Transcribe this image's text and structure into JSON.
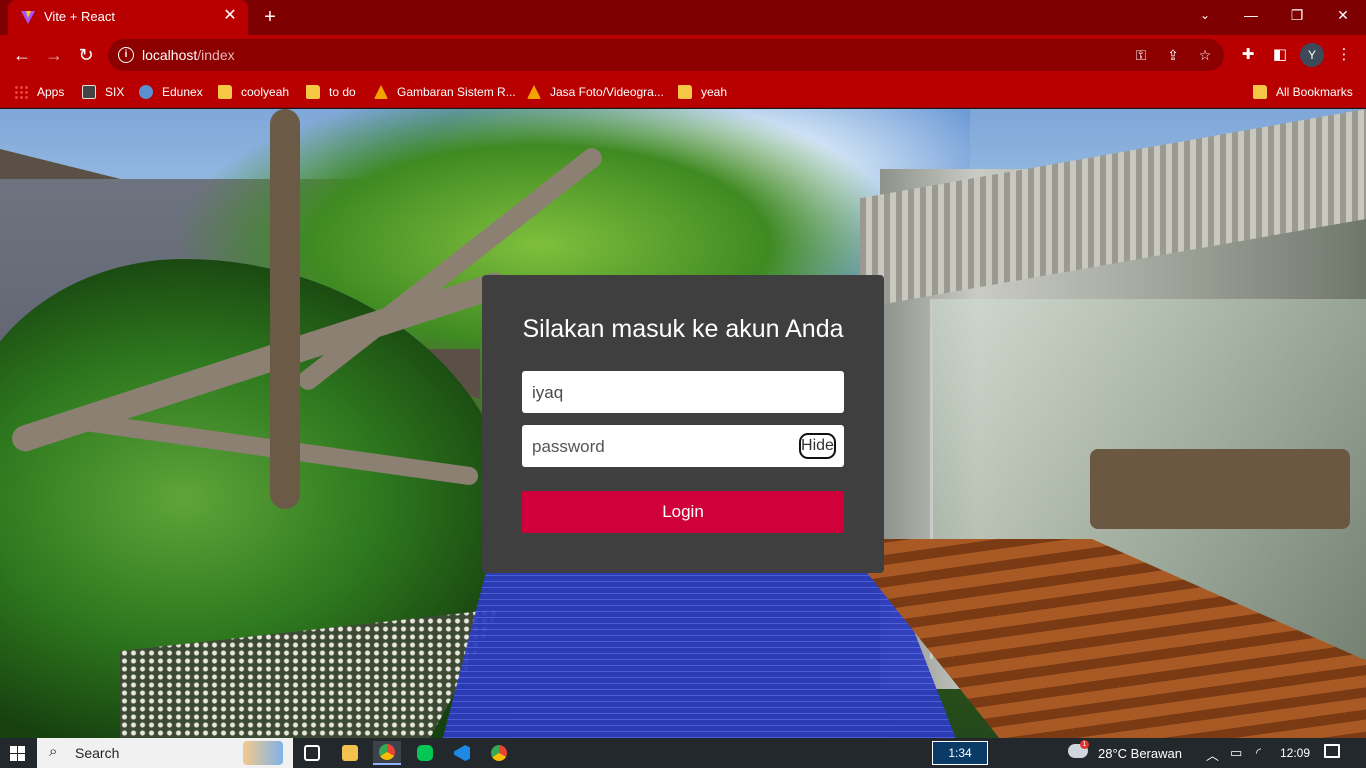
{
  "browser": {
    "tab_title": "Vite + React",
    "tab_close": "✕",
    "new_tab": "+",
    "window_controls": {
      "minimize": "—",
      "restore": "❐",
      "close": "✕"
    },
    "nav": {
      "back": "←",
      "forward": "→",
      "reload": "↻"
    },
    "url_host": "localhost",
    "url_path": "/index",
    "omnibox_icons": [
      "key-icon",
      "share-icon",
      "star-icon"
    ],
    "profile_initial": "Y",
    "bookmarks": [
      {
        "label": "Apps",
        "icon": "apps-icon"
      },
      {
        "label": "SIX",
        "icon": "six-icon"
      },
      {
        "label": "Edunex",
        "icon": "edunex-icon"
      },
      {
        "label": "coolyeah",
        "icon": "folder-icon"
      },
      {
        "label": "to do",
        "icon": "folder-icon"
      },
      {
        "label": "Gambaran Sistem R...",
        "icon": "drive-icon"
      },
      {
        "label": "Jasa Foto/Videogra...",
        "icon": "drive-icon"
      },
      {
        "label": "yeah",
        "icon": "folder-icon"
      }
    ],
    "all_bookmarks": "All Bookmarks"
  },
  "login": {
    "title": "Silakan masuk ke akun Anda",
    "username_value": "iyaq",
    "password_placeholder": "password",
    "toggle_label": "Hide",
    "submit_label": "Login"
  },
  "taskbar": {
    "search_label": "Search",
    "recorder_time": "1:34",
    "weather_badge": "1",
    "weather": "28°C  Berawan",
    "time": "12:09"
  }
}
